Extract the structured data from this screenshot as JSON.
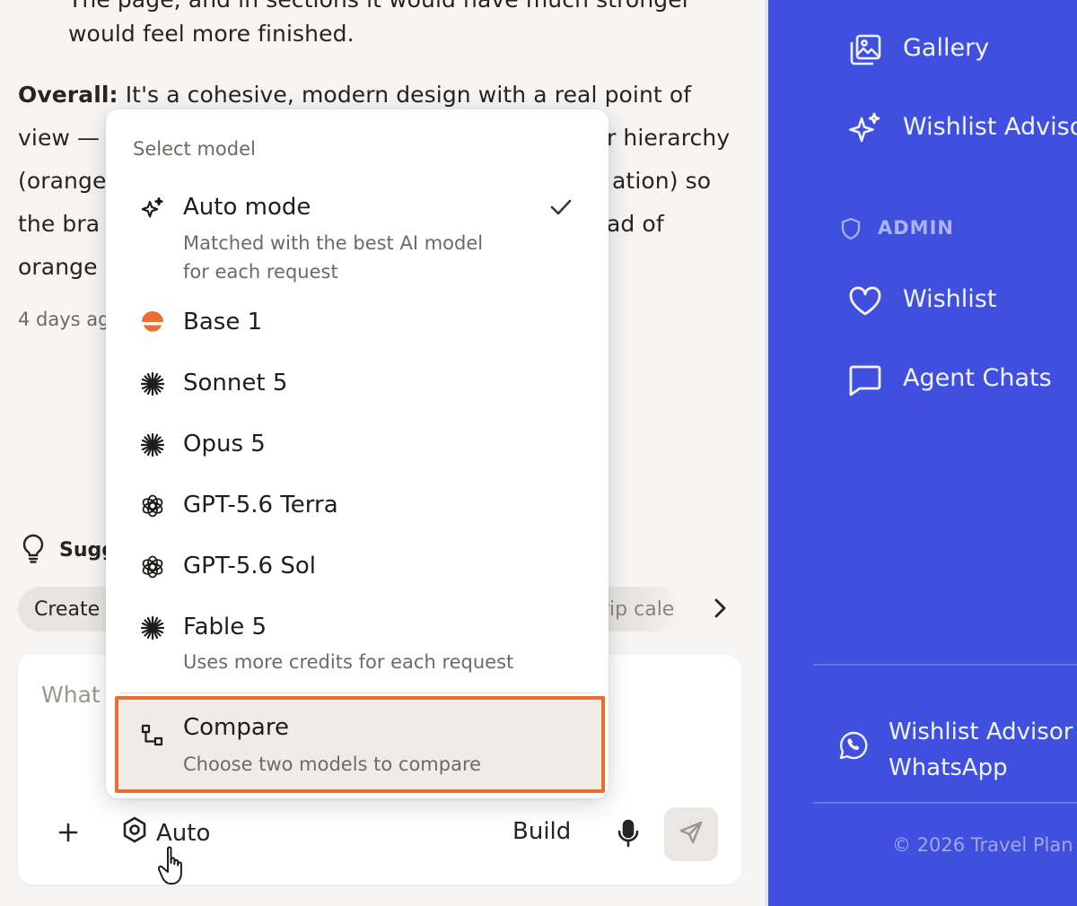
{
  "chat": {
    "lines": [
      "The page, and in sections it would have much stronger",
      "would feel more finished.",
      "It's a cohesive, modern design with a real point of",
      "view —",
      "r hierarchy",
      "(orange",
      "ation) so",
      "the bra",
      "ad of",
      "orange"
    ],
    "overall_label": "Overall:",
    "timestamp": "4 days ag",
    "suggestions_label": "Sugg",
    "chips": [
      "Create",
      "rip cale"
    ],
    "composer_placeholder": "What",
    "auto_label": "Auto",
    "build_label": "Build"
  },
  "dropdown": {
    "title": "Select model",
    "items": [
      {
        "icon": "sparkle-icon",
        "name": "Auto mode",
        "desc1": "Matched with the best AI model",
        "desc2": "for each request",
        "selected": true
      },
      {
        "icon": "half-circle-icon",
        "name": "Base 1",
        "color": "#ea6e2e"
      },
      {
        "icon": "asterisk-icon",
        "name": "Sonnet 5"
      },
      {
        "icon": "asterisk-icon",
        "name": "Opus 5"
      },
      {
        "icon": "openai-icon",
        "name": "GPT-5.6 Terra"
      },
      {
        "icon": "openai-icon",
        "name": "GPT-5.6 Sol"
      },
      {
        "icon": "asterisk-icon",
        "name": "Fable 5",
        "desc1": "Uses more credits for each request"
      },
      {
        "icon": "flowchart-icon",
        "name": "Compare",
        "desc1": "Choose two models to compare",
        "highlighted": true
      }
    ]
  },
  "sidebar": {
    "items": [
      {
        "icon": "gallery-icon",
        "label": "Gallery"
      },
      {
        "icon": "sparkle-icon",
        "label": "Wishlist Advisor"
      },
      {
        "icon": "heart-icon",
        "label": "Wishlist"
      },
      {
        "icon": "chat-icon",
        "label": "Agent Chats"
      }
    ],
    "admin_label": "ADMIN",
    "whatsapp_line1": "Wishlist Advisor",
    "whatsapp_line2": "WhatsApp",
    "copyright": "© 2026 Travel Plan"
  },
  "colors": {
    "sidebar_bg": "#4050de",
    "highlight_border": "#ea6e2e",
    "base_icon": "#ea6e2e"
  }
}
